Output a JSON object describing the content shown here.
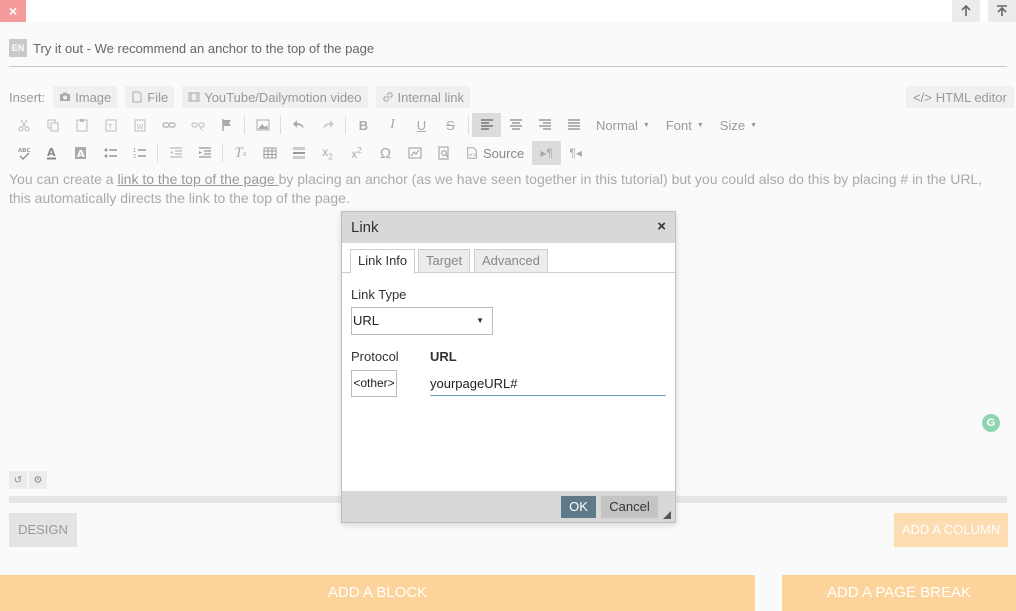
{
  "window": {
    "close_glyph": "×"
  },
  "block": {
    "lang": "EN",
    "title": "Try it out - We recommend an anchor to the top of the page"
  },
  "insert": {
    "label": "Insert:",
    "image": "Image",
    "file": "File",
    "video": "YouTube/Dailymotion video",
    "internal_link": "Internal link",
    "html_editor": "HTML editor"
  },
  "toolbar": {
    "format": "Normal",
    "font": "Font",
    "size": "Size",
    "source": "Source"
  },
  "content": {
    "pre": "You can create a ",
    "link": "link to the top of the page ",
    "post": "by placing an anchor (as we have seen together in this tutorial) but you could also do this by placing # in the URL, this automatically directs the link to the top of the page."
  },
  "dialog": {
    "title": "Link",
    "close": "×",
    "tabs": [
      "Link Info",
      "Target",
      "Advanced"
    ],
    "link_type_label": "Link Type",
    "link_type_value": "URL",
    "protocol_label": "Protocol",
    "protocol_value": "<other>",
    "url_label": "URL",
    "url_value": "yourpageURL#",
    "ok": "OK",
    "cancel": "Cancel"
  },
  "actions": {
    "design": "DESIGN",
    "add_column": "ADD A COLUMN",
    "add_block": "ADD A BLOCK",
    "add_page_break": "ADD A PAGE BREAK"
  },
  "grammarly": "G",
  "colors": {
    "accent": "#fcd49b",
    "close": "#f59b9b",
    "ok": "#5e7a8a"
  }
}
